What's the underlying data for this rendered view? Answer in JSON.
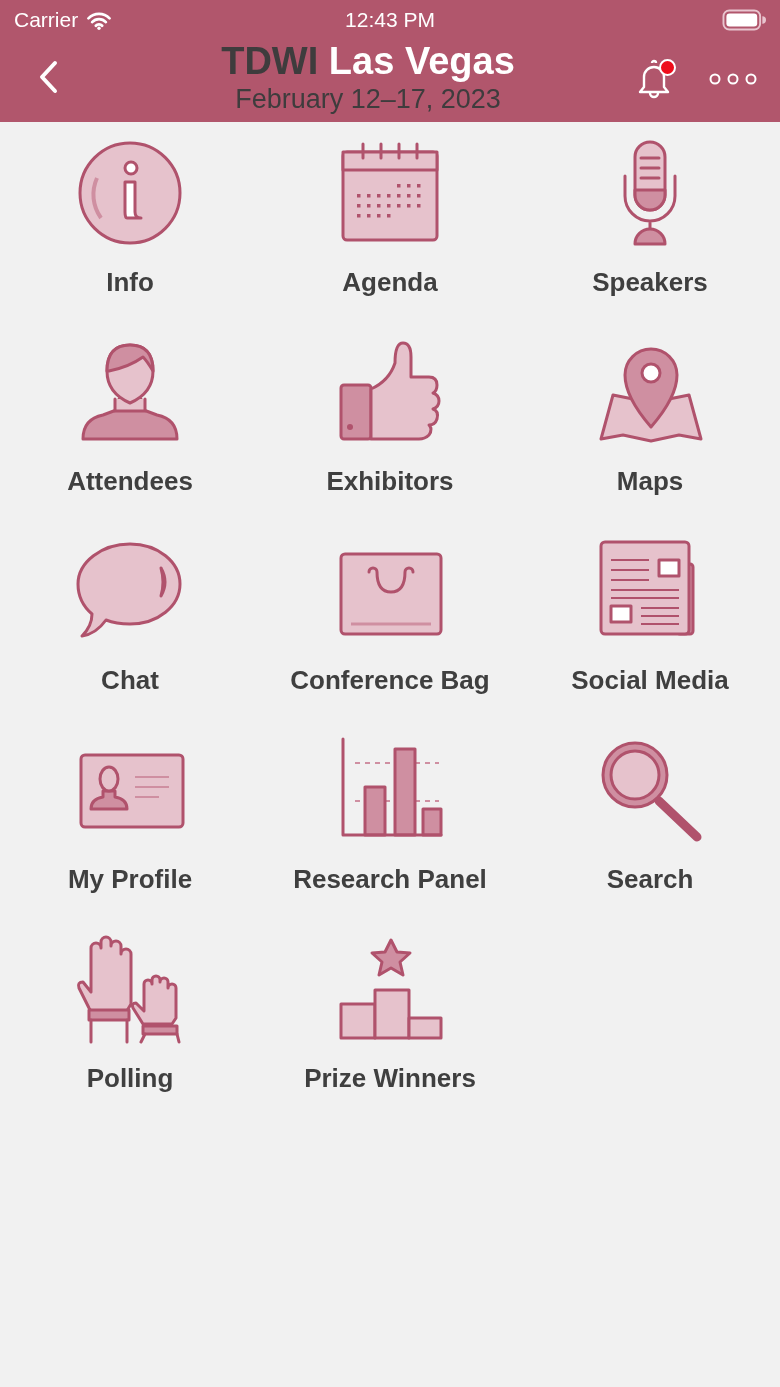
{
  "status_bar": {
    "carrier": "Carrier",
    "time": "12:43 PM"
  },
  "header": {
    "title_brand": "TDWI",
    "title_place": "Las Vegas",
    "subtitle": "February 12–17, 2023",
    "notification_badge": true
  },
  "tiles": [
    {
      "label": "Info",
      "kind": "info"
    },
    {
      "label": "Agenda",
      "kind": "calendar"
    },
    {
      "label": "Speakers",
      "kind": "microphone"
    },
    {
      "label": "Attendees",
      "kind": "person"
    },
    {
      "label": "Exhibitors",
      "kind": "thumb"
    },
    {
      "label": "Maps",
      "kind": "map"
    },
    {
      "label": "Chat",
      "kind": "bubble"
    },
    {
      "label": "Conference Bag",
      "kind": "bag"
    },
    {
      "label": "Social Media",
      "kind": "newspaper"
    },
    {
      "label": "My Profile",
      "kind": "idcard"
    },
    {
      "label": "Research Panel",
      "kind": "barchart"
    },
    {
      "label": "Search",
      "kind": "search"
    },
    {
      "label": "Polling",
      "kind": "hands"
    },
    {
      "label": "Prize Winners",
      "kind": "podium"
    }
  ]
}
